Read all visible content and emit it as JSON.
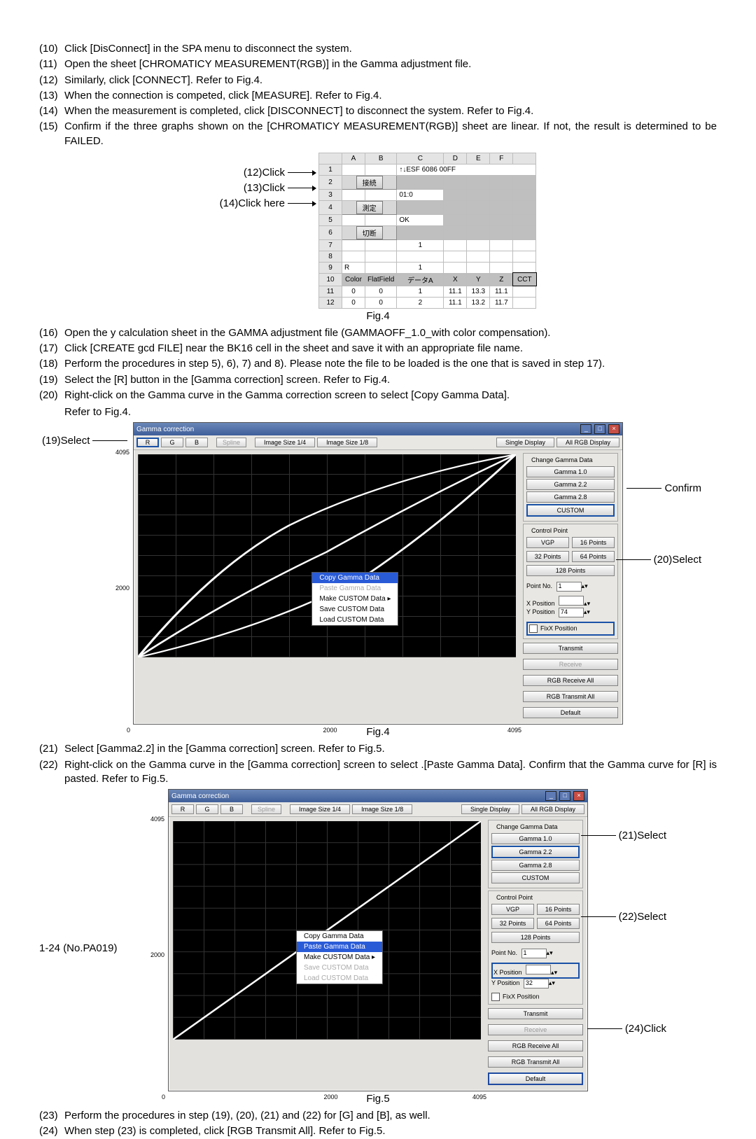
{
  "steps_a": [
    {
      "n": "(10)",
      "t": "Click [DisConnect] in the SPA menu to disconnect the system."
    },
    {
      "n": "(11)",
      "t": "Open the sheet [CHROMATICY MEASUREMENT(RGB)] in the Gamma adjustment file."
    },
    {
      "n": "(12)",
      "t": "Similarly, click [CONNECT]. Refer to Fig.4."
    },
    {
      "n": "(13)",
      "t": "When the connection is competed, click [MEASURE]. Refer to Fig.4."
    },
    {
      "n": "(14)",
      "t": "When the measurement is completed, click [DISCONNECT] to disconnect the system. Refer to Fig.4."
    },
    {
      "n": "(15)",
      "t": "Confirm if the three graphs shown on the [CHROMATICY MEASUREMENT(RGB)] sheet are linear. If not, the result is determined to be FAILED."
    }
  ],
  "fig4a": {
    "labels": [
      "(12)Click",
      "(13)Click",
      "(14)Click here"
    ],
    "cols": [
      "",
      "A",
      "B",
      "C",
      "D",
      "E",
      "F",
      ""
    ],
    "row1_text": "↑↓ESF 6086 00FF",
    "btn_connect": "接続",
    "row3_text": "01:0",
    "btn_measure": "測定",
    "row5_text": "OK",
    "btn_disconnect": "切断",
    "headers": [
      "Color",
      "FlatField",
      "データA",
      "X",
      "Y",
      "Z",
      "CCT"
    ],
    "data_rows": [
      [
        "0",
        "0",
        "1",
        "11.1",
        "13.3",
        "11.1",
        ""
      ],
      [
        "0",
        "0",
        "2",
        "11.1",
        "13.2",
        "11.7",
        ""
      ]
    ],
    "caption": "Fig.4"
  },
  "steps_b": [
    {
      "n": "(16)",
      "t": "Open the y calculation sheet in the GAMMA adjustment file (GAMMAOFF_1.0_with color compensation)."
    },
    {
      "n": "(17)",
      "t": "Click [CREATE gcd FILE] near the BK16 cell in the sheet and save it with an appropriate file name."
    },
    {
      "n": "(18)",
      "t": "Perform the procedures in step 5), 6), 7) and 8). Please note the file to be loaded is the one that is saved in step 17)."
    },
    {
      "n": "(19)",
      "t": "Select the [R] button in the [Gamma correction] screen. Refer to Fig.4."
    },
    {
      "n": "(20)",
      "t": "Right-click on the Gamma curve in the Gamma correction screen to select [Copy Gamma Data]."
    }
  ],
  "step20_sub": "Refer to Fig.4.",
  "gcw": {
    "title": "Gamma correction",
    "tb": {
      "r": "R",
      "g": "G",
      "b": "B",
      "spline": "Spline",
      "is14": "Image Size 1/4",
      "is18": "Image Size 1/8",
      "single": "Single Display",
      "allrgb": "All RGB Display"
    },
    "axis": {
      "y_top": "4095",
      "y_mid": "2000",
      "y_bot": "0",
      "x_mid": "2000",
      "x_end": "4095"
    },
    "ctx1": [
      "Copy Gamma Data",
      "Paste Gamma Data",
      "Make CUSTOM Data  ▸",
      "Save CUSTOM Data",
      "Load CUSTOM Data"
    ],
    "ctx2": [
      "Copy Gamma Data",
      "Paste Gamma Data",
      "Make CUSTOM Data  ▸",
      "Save CUSTOM Data",
      "Load CUSTOM Data"
    ],
    "panel": {
      "change_title": "Change Gamma Data",
      "g10": "Gamma 1.0",
      "g22": "Gamma 2.2",
      "g28": "Gamma 2.8",
      "custom": "CUSTOM",
      "cp_title": "Control Point",
      "vgp": "VGP",
      "p16": "16 Points",
      "p32": "32 Points",
      "p64": "64 Points",
      "p128": "128 Points",
      "pointno": "Point No.",
      "pointno_val": "1",
      "xpos": "X Position",
      "xpos_val": "",
      "ypos": "Y Position",
      "ypos_val1": "74",
      "ypos_val2": "32",
      "fix": "FixX Position",
      "transmit": "Transmit",
      "receive": "Receive",
      "rgbr": "RGB Receive All",
      "rgbt": "RGB Transmit All",
      "default": "Default"
    },
    "caption1": "Fig.4",
    "caption2": "Fig.5"
  },
  "callouts": {
    "c19": "(19)Select",
    "cConfirm": "Confirm",
    "c20": "(20)Select",
    "c21": "(21)Select",
    "c22": "(22)Select",
    "c24": "(24)Click"
  },
  "steps_c": [
    {
      "n": "(21)",
      "t": "Select [Gamma2.2] in the [Gamma correction] screen. Refer to Fig.5."
    },
    {
      "n": "(22)",
      "t": "Right-click on the Gamma curve in the [Gamma correction] screen to select .[Paste Gamma Data]. Confirm that the Gamma curve for [R] is pasted. Refer to Fig.5."
    }
  ],
  "steps_d": [
    {
      "n": "(23)",
      "t": "Perform the procedures in step (19), (20), (21) and (22) for [G] and [B], as well."
    },
    {
      "n": "(24)",
      "t": "When step (23) is completed, click [RGB Transmit All]. Refer to Fig.5."
    }
  ],
  "footer": "1-24 (No.PA019)"
}
